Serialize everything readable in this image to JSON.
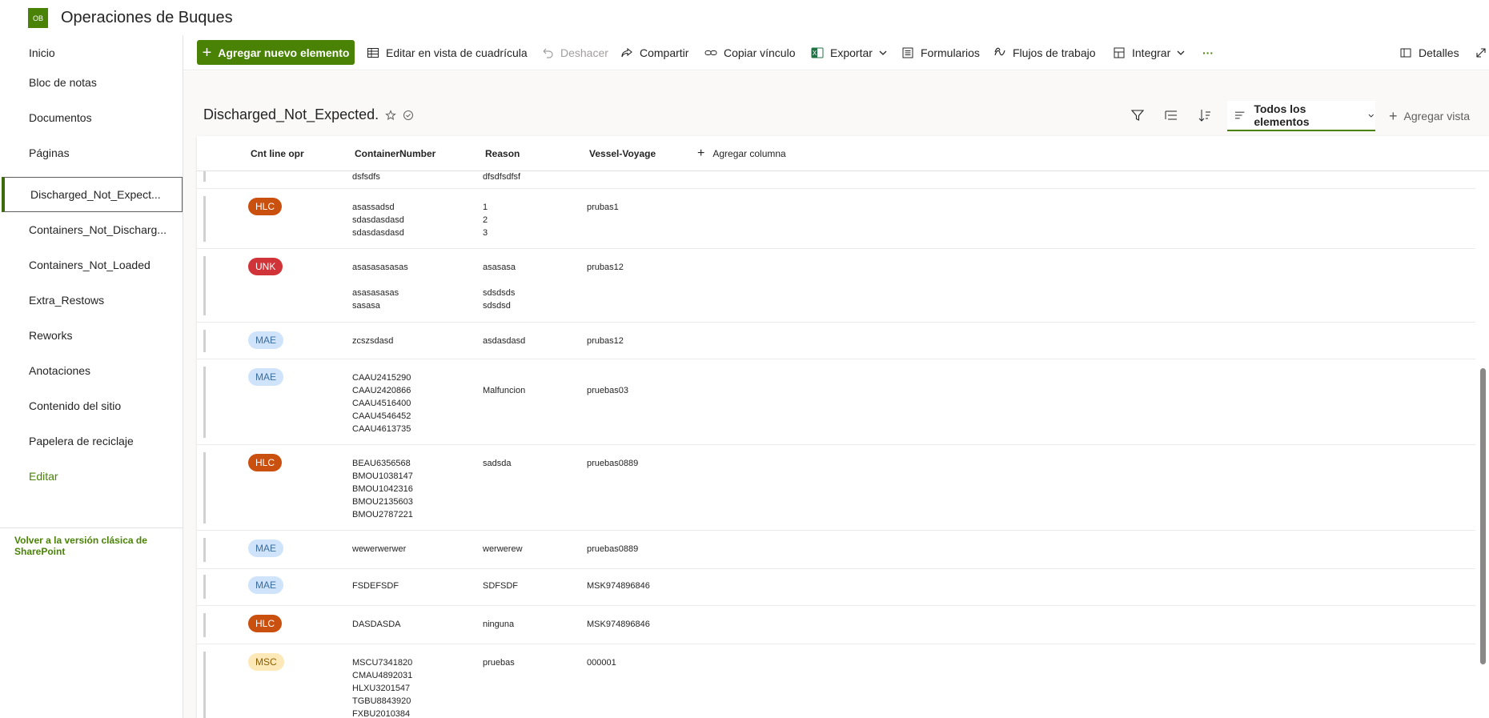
{
  "header": {
    "logo_text": "OB",
    "site_title": "Operaciones de Buques"
  },
  "nav": {
    "items": [
      {
        "label": "Inicio"
      },
      {
        "label": "Bloc de notas"
      },
      {
        "label": "Documentos"
      },
      {
        "label": "Páginas"
      },
      {
        "label": "Discharged_Not_Expect..."
      },
      {
        "label": "Containers_Not_Discharg..."
      },
      {
        "label": "Containers_Not_Loaded"
      },
      {
        "label": "Extra_Restows"
      },
      {
        "label": "Reworks"
      },
      {
        "label": "Anotaciones"
      },
      {
        "label": "Contenido del sitio"
      },
      {
        "label": "Papelera de reciclaje"
      },
      {
        "label": "Editar"
      }
    ],
    "classic_link": "Volver a la versión clásica de SharePoint"
  },
  "toolbar": {
    "new_item": "Agregar nuevo elemento",
    "grid_edit": "Editar en vista de cuadrícula",
    "undo": "Deshacer",
    "share": "Compartir",
    "copy_link": "Copiar vínculo",
    "export": "Exportar",
    "forms": "Formularios",
    "flows": "Flujos de trabajo",
    "integrate": "Integrar",
    "more": "···",
    "details": "Detalles"
  },
  "list": {
    "title": "Discharged_Not_Expected.",
    "view_name": "Todos los elementos",
    "add_view": "Agregar vista"
  },
  "columns": {
    "col1": "Cnt line opr",
    "col2": "ContainerNumber",
    "col3": "Reason",
    "col4": "Vessel-Voyage",
    "add": "Agregar columna"
  },
  "rows": [
    {
      "opr": "",
      "containers": [
        "dsfsdfs"
      ],
      "reasons": [
        "dfsdfsdfsf"
      ],
      "voyage": ""
    },
    {
      "opr": "HLC",
      "containers": [
        "asassadsd",
        "sdasdasdasd",
        "sdasdasdasd"
      ],
      "reasons": [
        "1",
        "2",
        "3"
      ],
      "voyage": "prubas1"
    },
    {
      "opr": "UNK",
      "containers": [
        "asasasasasas",
        "",
        "asasasasas",
        "sasasa"
      ],
      "reasons": [
        "asasasa",
        "",
        "sdsdsds",
        "sdsdsd"
      ],
      "voyage": "prubas12"
    },
    {
      "opr": "MAE",
      "containers": [
        "zcszsdasd"
      ],
      "reasons": [
        "asdasdasd"
      ],
      "voyage": "prubas12"
    },
    {
      "opr": "MAE",
      "containers": [
        "CAAU2415290",
        "CAAU2420866",
        "CAAU4516400",
        "CAAU4546452",
        "CAAU4613735"
      ],
      "reasons": [
        "Malfuncion"
      ],
      "voyage": "pruebas03"
    },
    {
      "opr": "HLC",
      "containers": [
        "BEAU6356568",
        "BMOU1038147",
        "BMOU1042316",
        "BMOU2135603",
        "BMOU2787221"
      ],
      "reasons": [
        "sadsda"
      ],
      "voyage": "pruebas0889"
    },
    {
      "opr": "MAE",
      "containers": [
        "wewerwerwer"
      ],
      "reasons": [
        "werwerew"
      ],
      "voyage": "pruebas0889"
    },
    {
      "opr": "MAE",
      "containers": [
        "FSDEFSDF"
      ],
      "reasons": [
        "SDFSDF"
      ],
      "voyage": "MSK974896846"
    },
    {
      "opr": "HLC",
      "containers": [
        "DASDASDA"
      ],
      "reasons": [
        "ninguna"
      ],
      "voyage": "MSK974896846"
    },
    {
      "opr": "MSC",
      "containers": [
        "MSCU7341820",
        "CMAU4892031",
        "HLXU3201547",
        "TGBU8843920",
        "FXBU2010384"
      ],
      "reasons": [
        "pruebas"
      ],
      "voyage": "000001"
    }
  ],
  "colors": {
    "brand": "#498205",
    "HLC": "#ca5010",
    "UNK": "#d13438",
    "MAE": "#cfe4fa",
    "MSC": "#fde8b7"
  }
}
